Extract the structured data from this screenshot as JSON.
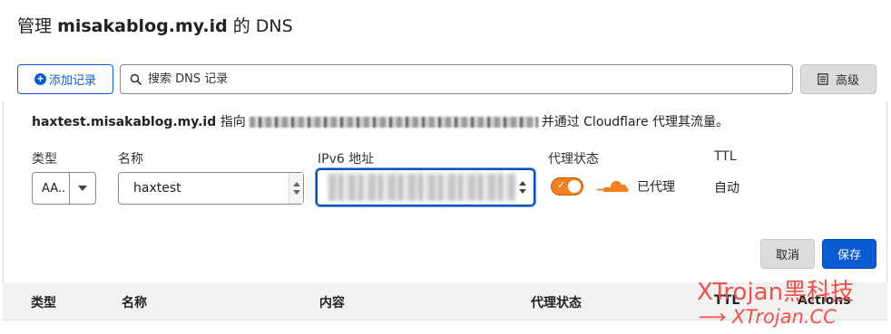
{
  "header": {
    "title_prefix": "管理",
    "domain": "misakablog.my.id",
    "title_suffix": "的 DNS"
  },
  "toolbar": {
    "add_record_label": "添加记录",
    "search_placeholder": "搜索 DNS 记录",
    "advanced_label": "高级"
  },
  "form": {
    "info_host": "haxtest.misakablog.my.id",
    "info_points_to": "指向",
    "info_suffix": "并通过 Cloudflare 代理其流量。",
    "labels": {
      "type": "类型",
      "name": "名称",
      "ipv6": "IPv6 地址",
      "proxy_status": "代理状态",
      "ttl": "TTL"
    },
    "type_value": "AA..",
    "name_value": "haxtest",
    "proxy_status_value": "已代理",
    "ttl_value": "自动",
    "cancel_label": "取消",
    "save_label": "保存"
  },
  "table": {
    "headers": [
      "类型",
      "名称",
      "内容",
      "代理状态",
      "TTL",
      "Actions"
    ]
  },
  "watermark": {
    "line1": "XTrojan黑科技",
    "line2": "XTrojan.CC"
  },
  "colors": {
    "primary": "#0b5bd3",
    "proxy_orange": "#f28022",
    "watermark": "#f2514a"
  }
}
